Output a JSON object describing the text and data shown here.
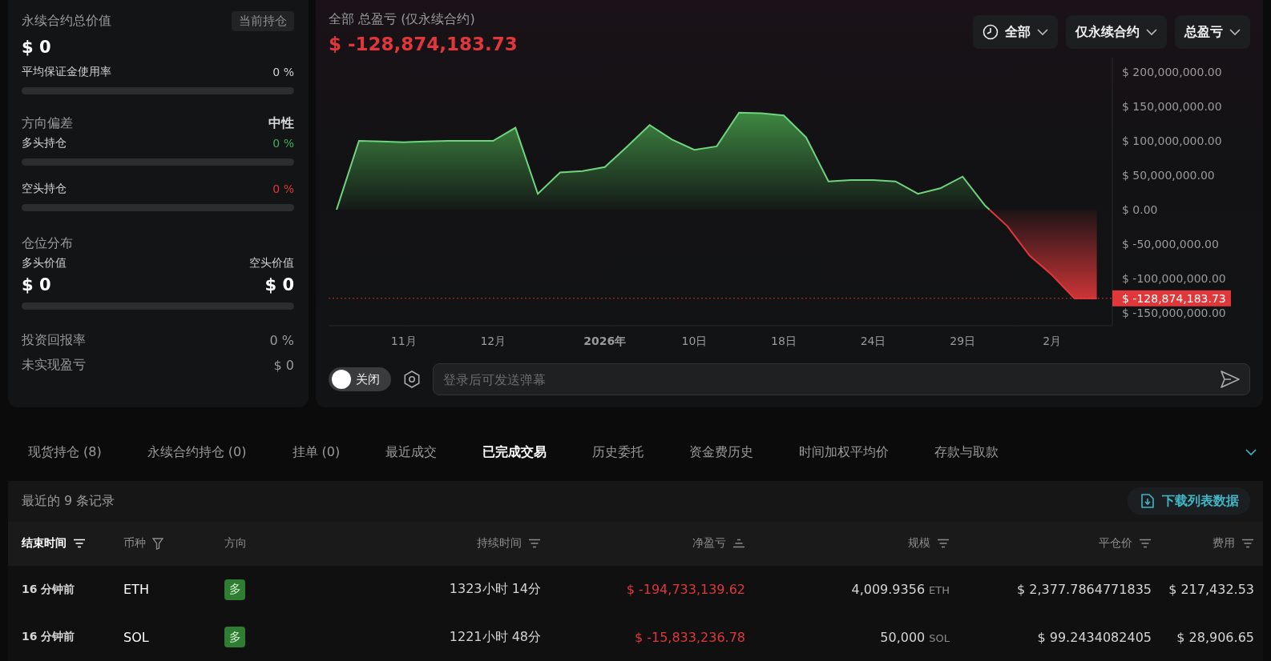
{
  "summary": {
    "title": "永续合约总价值",
    "tag": "当前持仓",
    "value": "$ 0",
    "margin": {
      "label": "平均保证金使用率",
      "value": "0 %",
      "level": 0
    },
    "bias": {
      "title": "方向偏差",
      "value": "中性",
      "long": {
        "label": "多头持仓",
        "value": "0 %",
        "level": 0
      },
      "short": {
        "label": "空头持仓",
        "value": "0 %",
        "level": 0
      }
    },
    "distribution": {
      "title": "仓位分布",
      "long_label": "多头价值",
      "short_label": "空头价值",
      "long_value": "$ 0",
      "short_value": "$ 0",
      "level": 0
    },
    "stats": [
      {
        "label": "投资回报率",
        "value": "0 %"
      },
      {
        "label": "未实现盈亏",
        "value": "$ 0"
      }
    ]
  },
  "pnl": {
    "title": "全部 总盈亏 (仅永续合约)",
    "value": "$ -128,874,183.73",
    "filters": [
      {
        "label": "全部",
        "kind": "time"
      },
      {
        "label": "仅永续合约",
        "kind": "plain"
      },
      {
        "label": "总盈亏",
        "kind": "plain"
      }
    ],
    "chart_data": {
      "type": "area",
      "categories": [
        null,
        null,
        null,
        "11月",
        null,
        null,
        null,
        "12月",
        null,
        null,
        null,
        null,
        "2026年",
        null,
        null,
        null,
        "10日",
        null,
        null,
        null,
        "18日",
        null,
        null,
        null,
        "24日",
        null,
        null,
        null,
        "29日",
        null,
        null,
        null,
        "2月",
        null,
        null
      ],
      "series": [
        {
          "color": "#4caf50",
          "values": [
            0,
            100000000,
            99000000,
            98000000,
            99000000,
            100000000,
            100000000,
            100000000,
            119000000,
            23000000,
            54000000,
            56000000,
            62000000,
            92000000,
            123000000,
            102000000,
            87000000,
            92000000,
            141000000,
            140000000,
            137000000,
            105000000,
            41000000,
            43000000,
            43000000,
            41000000,
            23000000,
            31000000,
            48000000,
            6000000,
            -24000000,
            -67000000,
            -95000000,
            -129000000,
            -129000000
          ]
        }
      ],
      "ylim": [
        -168600000,
        220900000
      ],
      "yticks": [
        {
          "value": 200000000,
          "label": "$ 200,000,000.00"
        },
        {
          "value": 150000000,
          "label": "$ 150,000,000.00"
        },
        {
          "value": 100000000,
          "label": "$ 100,000,000.00"
        },
        {
          "value": 50000000,
          "label": "$ 50,000,000.00"
        },
        {
          "value": 0,
          "label": "$ 0.00"
        },
        {
          "value": -50000000,
          "label": "$ -50,000,000.00"
        },
        {
          "value": -100000000,
          "label": "$ -100,000,000.00"
        },
        {
          "value": -150000000,
          "label": "$ -150,000,000.00"
        }
      ],
      "ref_lines": [
        {
          "axis": "y",
          "value": -128874183.73,
          "color": "#c0392b"
        }
      ],
      "annotations": [
        "$ -128,874,183.73"
      ]
    },
    "danmaku": {
      "toggle": {
        "label": "关闭",
        "on": false
      },
      "placeholder": "登录后可发送弹幕"
    }
  },
  "tabs": [
    {
      "label": "现货持仓 (8)",
      "selected": false
    },
    {
      "label": "永续合约持仓 (0)",
      "selected": false
    },
    {
      "label": "挂单 (0)",
      "selected": false
    },
    {
      "label": "最近成交",
      "selected": false
    },
    {
      "label": "已完成交易",
      "selected": true
    },
    {
      "label": "历史委托",
      "selected": false
    },
    {
      "label": "资金费历史",
      "selected": false
    },
    {
      "label": "时间加权平均价",
      "selected": false
    },
    {
      "label": "存款与取款",
      "selected": false
    }
  ],
  "records": {
    "label": "最近的 9 条记录",
    "download": "下载列表数据"
  },
  "table": {
    "columns": [
      {
        "label": "结束时间",
        "kind": "sort",
        "active": true
      },
      {
        "label": "币种",
        "kind": "filter",
        "active": false
      },
      {
        "label": "方向",
        "kind": "none",
        "active": false
      },
      {
        "label": "持续时间",
        "kind": "sort",
        "active": false
      },
      {
        "label": "净盈亏",
        "kind": "sorted",
        "active": false
      },
      {
        "label": "规模",
        "kind": "sort",
        "active": false
      },
      {
        "label": "平仓价",
        "kind": "sort",
        "active": false
      },
      {
        "label": "费用",
        "kind": "sort",
        "active": false
      }
    ],
    "rows": [
      {
        "end_time": "16 分钟前",
        "coin": "ETH",
        "direction": {
          "label": "多",
          "kind": "long"
        },
        "duration": "1323小时 14分",
        "pnl": "$ -194,733,139.62",
        "size": "4,009.9356",
        "size_unit": "ETH",
        "close_price": "$ 2,377.7864771835",
        "fee": "$ 217,432.53"
      },
      {
        "end_time": "16 分钟前",
        "coin": "SOL",
        "direction": {
          "label": "多",
          "kind": "long"
        },
        "duration": "1221小时 48分",
        "pnl": "$ -15,833,236.78",
        "size": "50,000",
        "size_unit": "SOL",
        "close_price": "$ 99.2434082405",
        "fee": "$ 28,906.65"
      }
    ]
  }
}
